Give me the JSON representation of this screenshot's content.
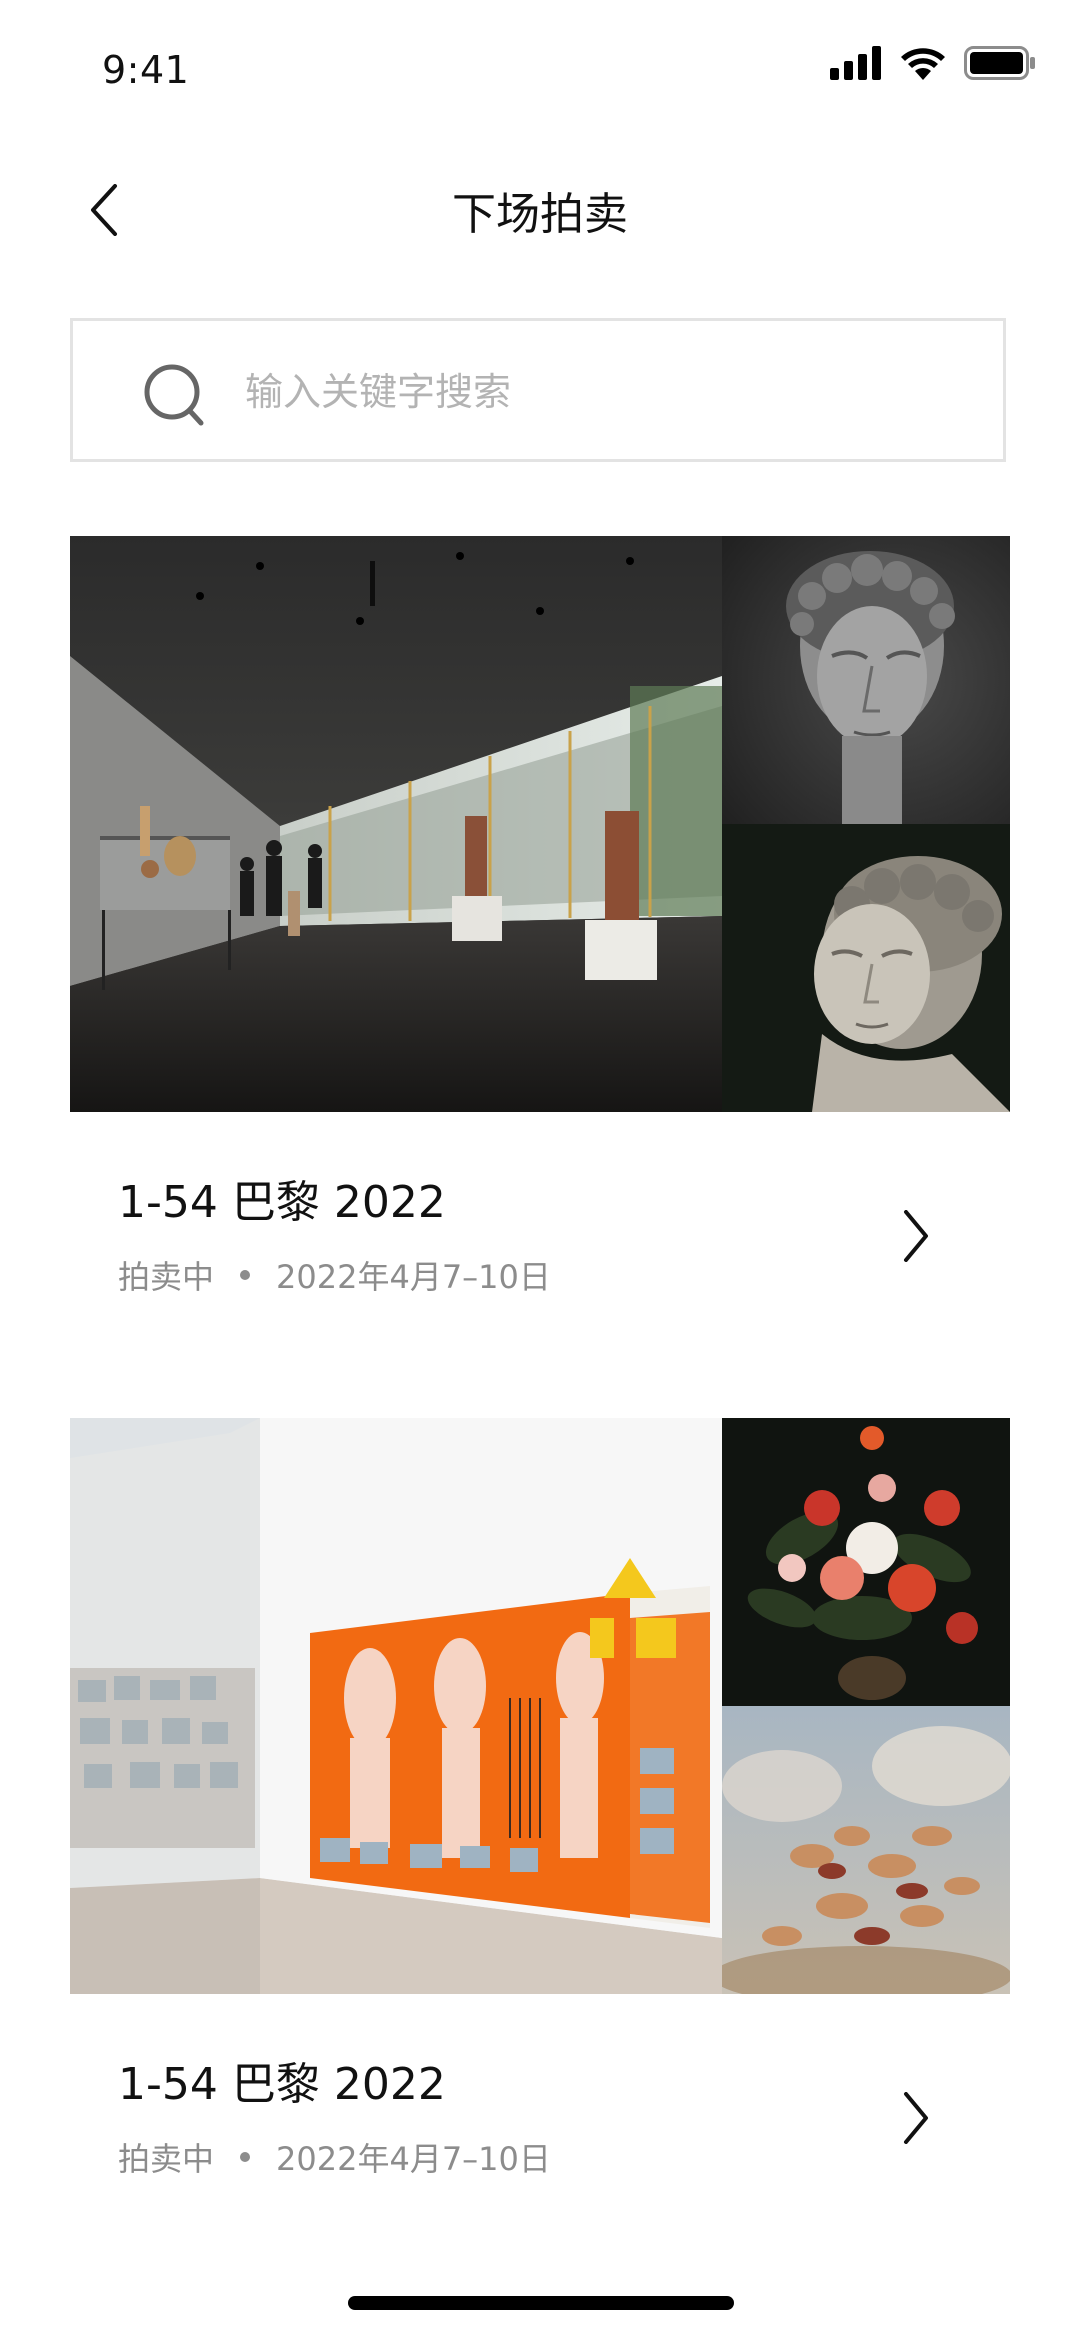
{
  "status_bar": {
    "time": "9:41",
    "icons": [
      "cellular-signal-icon",
      "wifi-icon",
      "battery-icon"
    ]
  },
  "nav": {
    "title": "下场拍卖",
    "back_icon": "chevron-left-icon"
  },
  "search": {
    "placeholder": "输入关键字搜索",
    "value": "",
    "icon": "search-icon"
  },
  "auctions": [
    {
      "title": "1-54 巴黎 2022",
      "status": "拍卖中",
      "date": "2022年4月7–10日",
      "images": [
        "gallery-interior-photo",
        "marble-head-sculpture-photo",
        "marble-bust-sculpture-photo"
      ]
    },
    {
      "title": "1-54 巴黎 2022",
      "status": "拍卖中",
      "date": "2022年4月7–10日",
      "images": [
        "orange-mural-gallery-photo",
        "flower-still-life-painting",
        "baroque-ceiling-painting"
      ]
    }
  ],
  "colors": {
    "background": "#ffffff",
    "text_primary": "#111111",
    "text_secondary": "#8c8c8c",
    "border": "#e3e3e3",
    "accent_orange": "#f26a12"
  }
}
